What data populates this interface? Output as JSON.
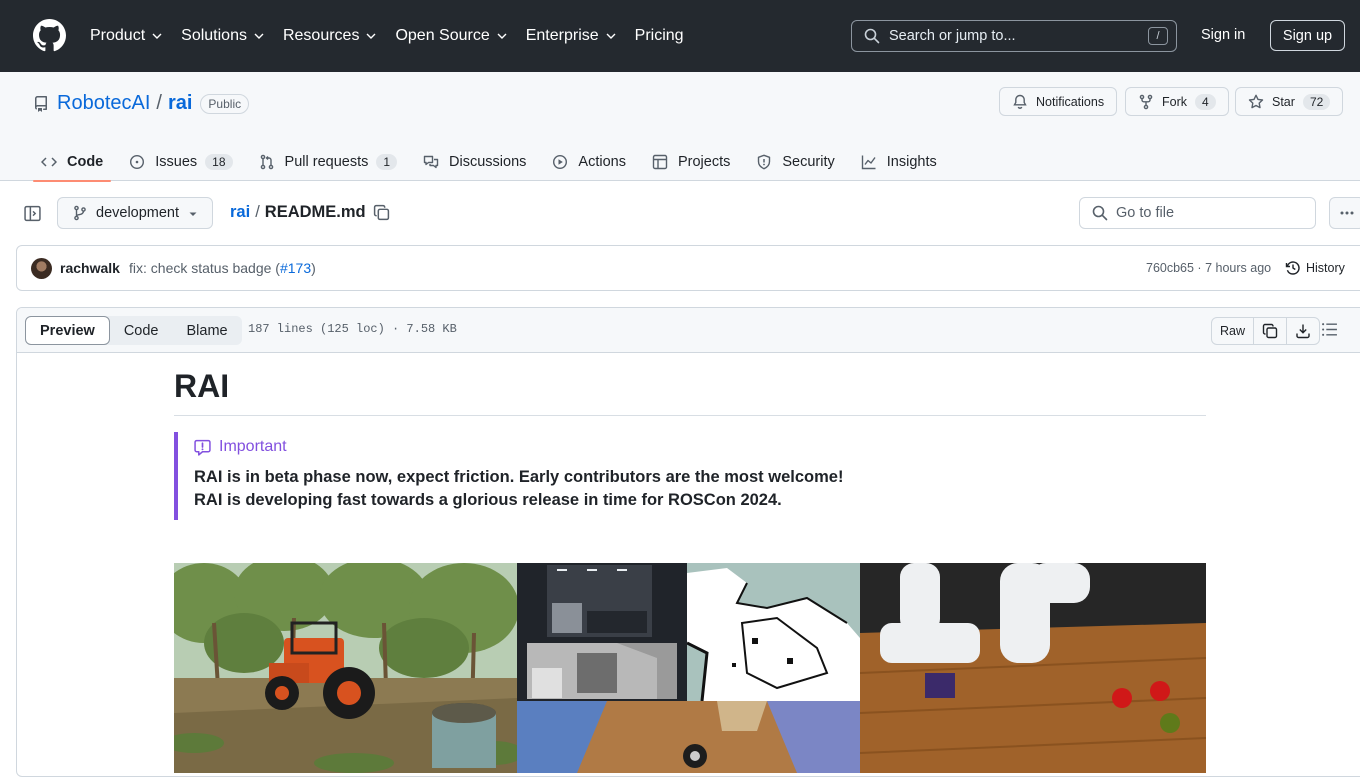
{
  "header": {
    "nav": [
      {
        "label": "Product",
        "has_menu": true
      },
      {
        "label": "Solutions",
        "has_menu": true
      },
      {
        "label": "Resources",
        "has_menu": true
      },
      {
        "label": "Open Source",
        "has_menu": true
      },
      {
        "label": "Enterprise",
        "has_menu": true
      },
      {
        "label": "Pricing",
        "has_menu": false
      }
    ],
    "search_placeholder": "Search or jump to...",
    "search_shortcut": "/",
    "sign_in": "Sign in",
    "sign_up": "Sign up"
  },
  "repo": {
    "owner": "RobotecAI",
    "separator": "/",
    "name": "rai",
    "visibility": "Public",
    "notifications_label": "Notifications",
    "fork_label": "Fork",
    "fork_count": "4",
    "star_label": "Star",
    "star_count": "72"
  },
  "tabs": [
    {
      "label": "Code",
      "count": "",
      "active": true,
      "icon": "code-icon"
    },
    {
      "label": "Issues",
      "count": "18",
      "icon": "issue-icon"
    },
    {
      "label": "Pull requests",
      "count": "1",
      "icon": "pull-request-icon"
    },
    {
      "label": "Discussions",
      "count": "",
      "icon": "discussion-icon"
    },
    {
      "label": "Actions",
      "count": "",
      "icon": "play-icon"
    },
    {
      "label": "Projects",
      "count": "",
      "icon": "table-icon"
    },
    {
      "label": "Security",
      "count": "",
      "icon": "shield-icon"
    },
    {
      "label": "Insights",
      "count": "",
      "icon": "graph-icon"
    }
  ],
  "filebar": {
    "branch": "development",
    "path_repo": "rai",
    "path_sep": "/",
    "path_file": "README.md",
    "goto_placeholder": "Go to file"
  },
  "commit": {
    "author": "rachwalk",
    "message": "fix: check status badge (",
    "pr": "#173",
    "message_end": ")",
    "hash_time": "760cb65 · 7 hours ago",
    "history": "History"
  },
  "viewer": {
    "modes": [
      "Preview",
      "Code",
      "Blame"
    ],
    "active_mode": "Preview",
    "info": "187 lines (125 loc) · 7.58 KB",
    "raw": "Raw"
  },
  "readme": {
    "title": "RAI",
    "alert_title": "Important",
    "alert_line1": "RAI is in beta phase now, expect friction. Early contributors are the most welcome!",
    "alert_line2": "RAI is developing fast towards a glorious release in time for ROSCon 2024."
  },
  "colors": {
    "header_bg": "#24292f",
    "link": "#0969da",
    "important": "#8250df",
    "tab_underline": "#fd8c73"
  }
}
